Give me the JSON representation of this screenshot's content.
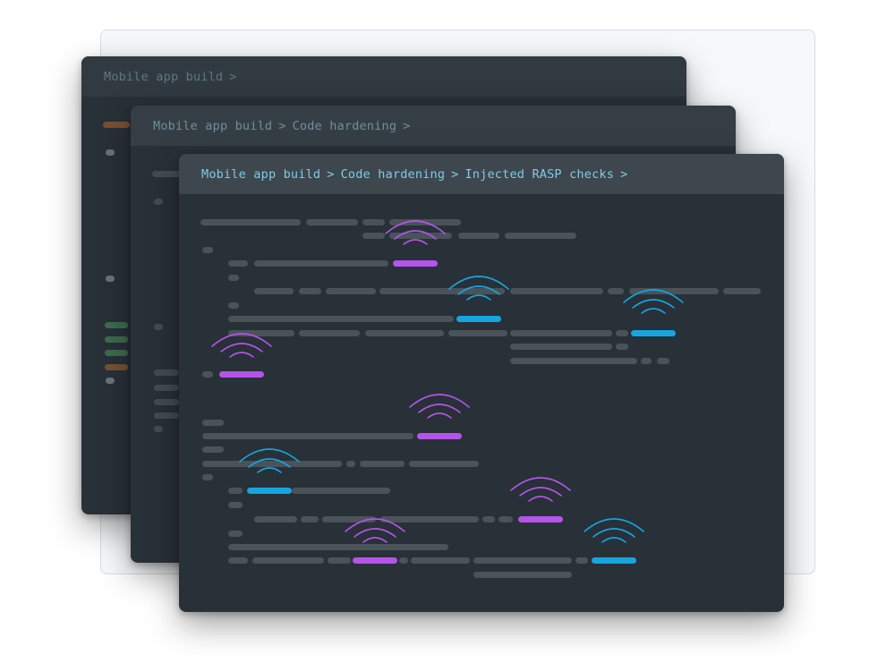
{
  "windows": {
    "back": {
      "breadcrumb": [
        "Mobile app build"
      ]
    },
    "mid": {
      "breadcrumb": [
        "Mobile app build",
        "Code hardening"
      ]
    },
    "front": {
      "breadcrumb": [
        "Mobile app build",
        "Code hardening",
        "Injected RASP checks"
      ]
    }
  },
  "breadcrumb_separator": ">",
  "icons": {
    "signal": "signal-waves-icon",
    "code_line": "code-line-placeholder"
  },
  "colors": {
    "purple_check": "#b553ea",
    "blue_check": "#16a5df",
    "code_bar": "#4a535a",
    "window_bg": "#283038",
    "front_title_text": "#7ecbe8"
  }
}
